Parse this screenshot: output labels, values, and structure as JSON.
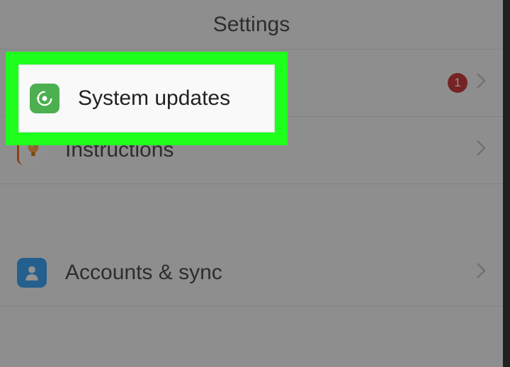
{
  "header": {
    "title": "Settings"
  },
  "items": {
    "system_updates": {
      "label": "System updates",
      "icon": "refresh-icon",
      "badge": "1"
    },
    "instructions": {
      "label": "Instructions",
      "icon": "bulb-icon"
    },
    "accounts_sync": {
      "label": "Accounts & sync",
      "icon": "person-icon"
    }
  },
  "highlight": {
    "label": "System updates"
  },
  "colors": {
    "highlight_green": "#1eff1e",
    "badge_red": "#c41e1e",
    "icon_green": "#4caf50",
    "icon_blue": "#2196f3",
    "icon_orange": "#e65c00"
  }
}
